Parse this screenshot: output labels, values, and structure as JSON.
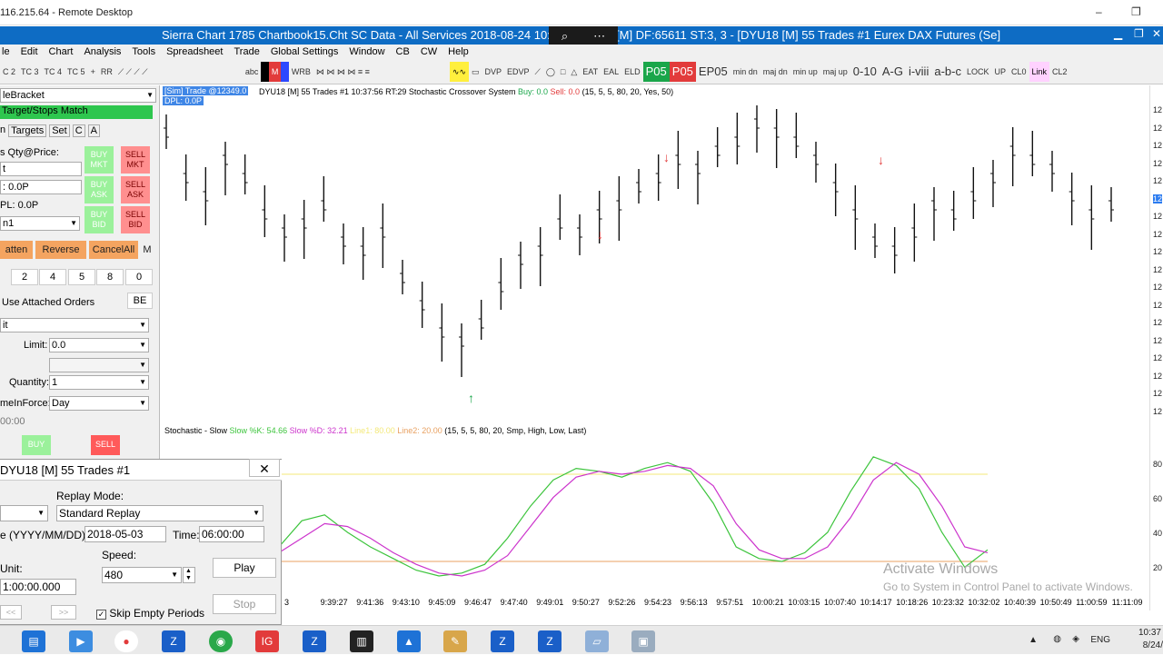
{
  "remote": {
    "title": "116.215.64 - Remote Desktop"
  },
  "sc": {
    "title": "Sierra Chart 1785 Chartbook15.Cht  SC Data - All Services 2018-08-24  10:3",
    "title_right": "[M]  DF:65611  ST:3, 3 - [DYU18 [M]  55 Trades  #1  Eurex DAX Futures (Se]"
  },
  "menu": [
    "le",
    "Edit",
    "Chart",
    "Analysis",
    "Tools",
    "Spreadsheet",
    "Trade",
    "Global Settings",
    "Window",
    "CB",
    "CW",
    "Help"
  ],
  "toolbar": [
    "C 2",
    "TC 3",
    "TC 4",
    "TC 5",
    "+",
    "RR",
    "abc",
    "M",
    "WRB",
    "DVP",
    "EDVP",
    "EAT",
    "EAL",
    "ELD",
    "P05",
    "P05",
    "EP05",
    "min dn",
    "maj dn",
    "min up",
    "maj up",
    "0-10",
    "A-G",
    "i-viii",
    "a-b-c",
    "LOCK",
    "UP",
    "CL0",
    "Link",
    "CL2"
  ],
  "left": {
    "order_type": "leBracket",
    "match": "Target/Stops Match",
    "tabs": [
      "n",
      "Targets",
      "Set",
      "C",
      "A"
    ],
    "qty_price": "s Qty@Price:",
    "field1": "t",
    "field2": ": 0.0P",
    "pl": "PL: 0.0P",
    "dd": "n1",
    "buy_mkt": "BUY MKT",
    "sell_mkt": "SELL MKT",
    "buy_ask": "BUY ASK",
    "sell_ask": "SELL ASK",
    "buy_bid": "BUY BID",
    "sell_bid": "SELL BID",
    "flatten": "atten",
    "reverse": "Reverse",
    "cancel": "CancelAll",
    "m": "M",
    "nums": [
      "2",
      "4",
      "5",
      "8",
      "0"
    ],
    "attached": "Use Attached Orders",
    "be": "BE",
    "type_val": "it",
    "limit_label": "Limit:",
    "limit_val": "0.0",
    "qty_label": "Quantity:",
    "qty_val": "1",
    "tif_label": "meInForce:",
    "tif_val": "Day",
    "time_val": "00:00",
    "buy": "BUY",
    "sell": "SELL"
  },
  "chart": {
    "header_sim": "[Sim]  Trade",
    "header_pl": "@12349.0",
    "header_pl2": "DPL: 0.0P",
    "header": "DYU18 [M]  55 Trades  #1 10:37:56 RT:29 Stochastic Crossover System",
    "buy_txt": "Buy: 0.0",
    "sell_txt": "Sell: 0.0",
    "params": "(15, 5, 5, 80, 20, Yes, 50)",
    "stoch_title": "Stochastic - Slow",
    "slowk": "Slow %K: 54.66",
    "slowd": "Slow %D: 32.21",
    "line1": "Line1: 80.00",
    "line2": "Line2: 20.00",
    "stoch_params": "(15, 5, 5, 80, 20, Smp, High, Low, Last)",
    "price_scale": [
      "12",
      "12",
      "12",
      "12",
      "12",
      "12",
      "12",
      "12",
      "12",
      "12",
      "12",
      "12",
      "12",
      "12",
      "12",
      "12",
      "12",
      "12"
    ],
    "osc_scale": [
      "80",
      "60",
      "40",
      "20"
    ],
    "time_labels": [
      "3",
      "9:39:27",
      "9:41:36",
      "9:43:10",
      "9:45:09",
      "9:46:47",
      "9:47:40",
      "9:49:01",
      "9:50:27",
      "9:52:26",
      "9:54:23",
      "9:56:13",
      "9:57:51",
      "10:00:21",
      "10:03:15",
      "10:07:40",
      "10:14:17",
      "10:18:26",
      "10:23:32",
      "10:32:02",
      "10:40:39",
      "10:50:49",
      "11:00:59",
      "11:11:09"
    ]
  },
  "chart_data": {
    "type": "line",
    "series": [
      {
        "name": "Slow %K",
        "color": "#3cc43c",
        "values": [
          30,
          48,
          52,
          40,
          30,
          22,
          14,
          10,
          12,
          18,
          36,
          58,
          76,
          84,
          82,
          78,
          84,
          88,
          82,
          60,
          30,
          22,
          20,
          26,
          40,
          68,
          92,
          86,
          70,
          40,
          16,
          28
        ]
      },
      {
        "name": "Slow %D",
        "color": "#cc33cc",
        "values": [
          26,
          36,
          46,
          44,
          36,
          26,
          18,
          12,
          10,
          14,
          24,
          44,
          64,
          78,
          82,
          80,
          82,
          86,
          84,
          72,
          46,
          28,
          22,
          22,
          30,
          50,
          76,
          88,
          80,
          58,
          30,
          26
        ]
      }
    ],
    "ylim": [
      0,
      100
    ],
    "line1": 80,
    "line2": 20
  },
  "replay": {
    "title": "DYU18 [M]  55 Trades  #1",
    "mode_label": "Replay Mode:",
    "mode_val": "Standard Replay",
    "date_label": "e (YYYY/MM/DD):",
    "date_val": "2018-05-03",
    "time_label": "Time:",
    "time_val": "06:00:00",
    "speed_label": "Speed:",
    "speed_val": "480",
    "unit_label": "Unit:",
    "unit_val": "1:00:00.000",
    "play": "Play",
    "stop": "Stop",
    "skip": "Skip Empty Periods",
    "prev": "<<",
    "next": ">>"
  },
  "watermark": {
    "line1": "Activate Windows",
    "line2": "Go to System in Control Panel to activate Windows."
  },
  "tray": {
    "lang": "ENG",
    "time": "10:37",
    "date": "8/24/"
  }
}
